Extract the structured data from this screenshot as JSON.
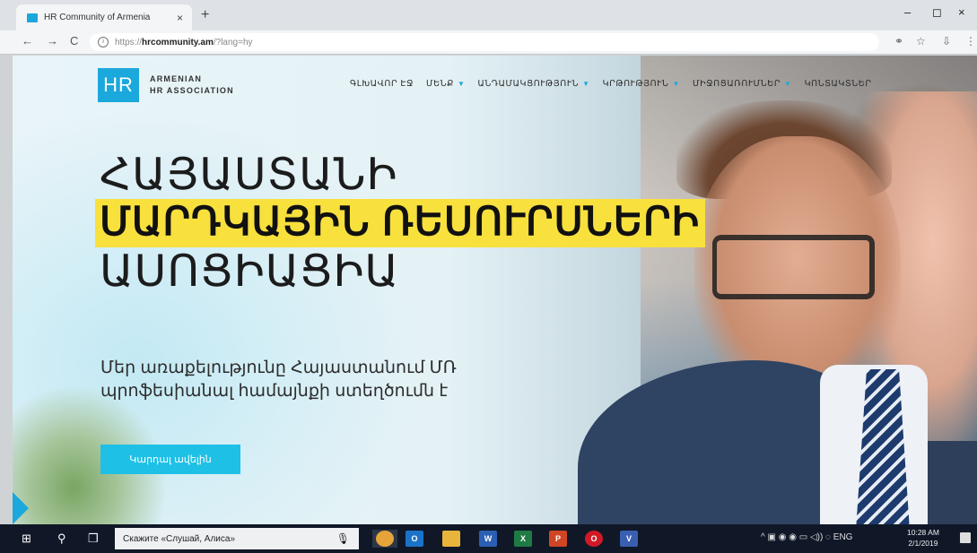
{
  "browser": {
    "tab_title": "HR Community of Armenia",
    "tab_close": "×",
    "new_tab": "+",
    "window_controls": [
      "–",
      "◻",
      "×"
    ],
    "nav": {
      "back": "←",
      "forward": "→",
      "reload": "C"
    },
    "url_prefix": "https://",
    "url_host": "hrcommunity.am",
    "url_rest": "/?lang=hy",
    "toolbar_right": [
      "⚭",
      "☆",
      "⇩",
      "⋮"
    ]
  },
  "site": {
    "logo_mark": "HR",
    "logo_line1": "ARMENIAN",
    "logo_line2": "HR ASSOCIATION",
    "nav": [
      {
        "label": "ԳԼԽԱՎՈՐ ԷՋ",
        "dropdown": false
      },
      {
        "label": "ՄԵՆՔ",
        "dropdown": true
      },
      {
        "label": "ԱՆԴԱՄԱԿՑՈՒԹՅՈՒՆ",
        "dropdown": true
      },
      {
        "label": "ԿՐԹՈՒԹՅՈՒՆ",
        "dropdown": true
      },
      {
        "label": "ՄԻՋՈՑԱՌՈՒՄՆԵՐ",
        "dropdown": true
      },
      {
        "label": "ԿՈՆՏԱԿՏՆԵՐ",
        "dropdown": false
      }
    ],
    "hero": {
      "line1": "ՀԱՅԱՍՏԱՆԻ",
      "line2": "ՄԱՐԴԿԱՅԻՆ ՌԵՍՈՒՐՍՆԵՐԻ",
      "line3": "ԱՍՈՑԻԱՑԻԱ",
      "subtitle": "Մեր առաքելությունը Հայաստանում ՄՌ պրոֆեսիանալ համայնքի ստեղծումն է",
      "cta": "Կարդալ ավելին"
    },
    "colors": {
      "brand": "#1ba8dc",
      "highlight": "#f8e03d",
      "cta": "#1ec0e6"
    }
  },
  "taskbar": {
    "start": "⊞",
    "search_icon": "⚲",
    "task_view": "❐",
    "search_placeholder": "Скажите «Слушай, Алиса»",
    "mic": "🎙",
    "apps": [
      {
        "name": "chrome",
        "label": "",
        "color": "#e5a33a"
      },
      {
        "name": "outlook",
        "label": "O",
        "color": "#1a73c9"
      },
      {
        "name": "explorer",
        "label": "",
        "color": "#e8b43c"
      },
      {
        "name": "word",
        "label": "W",
        "color": "#2b5fb3"
      },
      {
        "name": "excel",
        "label": "X",
        "color": "#1f7a44"
      },
      {
        "name": "powerpoint",
        "label": "P",
        "color": "#d04523"
      },
      {
        "name": "opera",
        "label": "O",
        "color": "#d01a25"
      },
      {
        "name": "visio",
        "label": "V",
        "color": "#3a5fb0"
      }
    ],
    "tray_text": "^ ▣ ◉ ◉ ▭ ◁)) ◌ ENG",
    "clock_time": "10:28 AM",
    "clock_date": "2/1/2019"
  }
}
